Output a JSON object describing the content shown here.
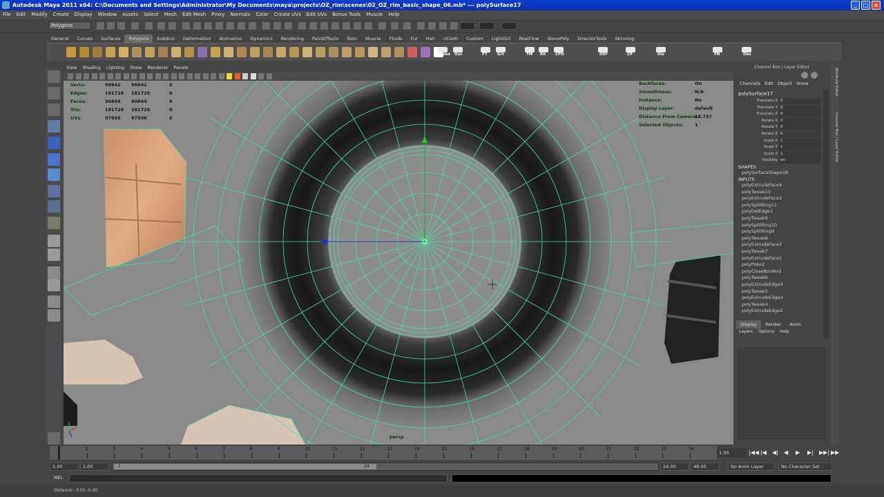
{
  "window": {
    "title": "Autodesk Maya 2011 x64: C:\\Documents and Settings\\Administrator\\My Documents\\maya\\projects\\OZ_rim\\scenes\\02_OZ_rim_basic_shape_06.mb*   ---   polySurface17"
  },
  "menubar": [
    "File",
    "Edit",
    "Modify",
    "Create",
    "Display",
    "Window",
    "Assets",
    "Select",
    "Mesh",
    "Edit Mesh",
    "Proxy",
    "Normals",
    "Color",
    "Create UVs",
    "Edit UVs",
    "Bonus Tools",
    "Muscle",
    "Help"
  ],
  "statusline": {
    "mode": "Polygons"
  },
  "shelf": {
    "tabs": [
      "General",
      "Curves",
      "Surfaces",
      "Polygons",
      "Subdivs",
      "Deformation",
      "Animation",
      "Dynamics",
      "Rendering",
      "PaintEffects",
      "Toon",
      "Muscle",
      "Fluids",
      "Fur",
      "Hair",
      "nCloth",
      "Custom",
      "LightGirl",
      "RealFlow",
      "StevePoly",
      "DirectorTools",
      "Skinning"
    ],
    "active_tab": "Polygons",
    "labels": [
      "Hshd",
      "Out",
      "FT",
      "Grt",
      "TM",
      "All",
      "CPD",
      "DEF",
      "CP",
      "His",
      "FN",
      "Des"
    ]
  },
  "panel": {
    "menus": [
      "View",
      "Shading",
      "Lighting",
      "Show",
      "Renderer",
      "Panels"
    ]
  },
  "hud": {
    "left_rows": [
      {
        "label": "Verts:",
        "a": "98842",
        "b": "98842",
        "c": "0"
      },
      {
        "label": "Edges:",
        "a": "181728",
        "b": "181728",
        "c": "0"
      },
      {
        "label": "Faces:",
        "a": "90864",
        "b": "90864",
        "c": "0"
      },
      {
        "label": "Tris:",
        "a": "181728",
        "b": "181728",
        "c": "0"
      },
      {
        "label": "UVs:",
        "a": "97506",
        "b": "97506",
        "c": "0"
      }
    ],
    "right_rows": [
      {
        "label": "Backfaces:",
        "value": "On"
      },
      {
        "label": "Smoothness:",
        "value": "N/A"
      },
      {
        "label": "Instance:",
        "value": "No"
      },
      {
        "label": "Display Layer:",
        "value": "default"
      },
      {
        "label": "Distance From Camera:",
        "value": "18.737"
      },
      {
        "label": "Selected Objects:",
        "value": "1"
      }
    ],
    "camera": "persp"
  },
  "channel_box": {
    "title": "Channel Box / Layer Editor",
    "menus": [
      "Channels",
      "Edit",
      "Object",
      "Show"
    ],
    "object": "polySurface17",
    "attributes": [
      {
        "name": "Translate X",
        "value": "0"
      },
      {
        "name": "Translate Y",
        "value": "0"
      },
      {
        "name": "Translate Z",
        "value": "0"
      },
      {
        "name": "Rotate X",
        "value": "0"
      },
      {
        "name": "Rotate Y",
        "value": "0"
      },
      {
        "name": "Rotate Z",
        "value": "0"
      },
      {
        "name": "Scale X",
        "value": "1"
      },
      {
        "name": "Scale Y",
        "value": "1"
      },
      {
        "name": "Scale Z",
        "value": "1"
      },
      {
        "name": "Visibility",
        "value": "on"
      }
    ],
    "shapes_header": "SHAPES",
    "shape": "polySurfaceShape18",
    "inputs_header": "INPUTS",
    "inputs": [
      "polyExtrudeFace4",
      "polyTweak10",
      "polyExtrudeFace3",
      "polySplitRing11",
      "polyDelEdge3",
      "polyTweak9",
      "polySplitRing10",
      "polySplitRing9",
      "polyTweak8",
      "polyExtrudeFace2",
      "polyTweak7",
      "polyExtrudeFace1",
      "polyPoke2",
      "polyCloseBorder2",
      "polyTweak6",
      "polyExtrudeEdge4",
      "polyTweak5",
      "polyExtrudeEdge3",
      "polyTweak4",
      "polyExtrudeEdge2"
    ]
  },
  "layer_editor": {
    "tabs": [
      "Display",
      "Render",
      "Anim"
    ],
    "active_tab": "Display",
    "menus": [
      "Layers",
      "Options",
      "Help"
    ]
  },
  "side_tabs": [
    "Attribute Editor",
    "Channel Box / Layer Editor"
  ],
  "timeline": {
    "ticks": [
      "1",
      "2",
      "3",
      "4",
      "5",
      "6",
      "7",
      "8",
      "9",
      "10",
      "11",
      "12",
      "13",
      "14",
      "15",
      "16",
      "17",
      "18",
      "19",
      "20",
      "21",
      "22",
      "23",
      "24"
    ],
    "current_frame": "1.00"
  },
  "range": {
    "start": "1.00",
    "inner_start": "1.00",
    "slider_start": "1",
    "slider_end": "24",
    "inner_end": "24.00",
    "end": "48.00",
    "anim_layer": "No Anim Layer",
    "char_set": "No Character Set"
  },
  "command": {
    "label": "MEL"
  },
  "help_line": "Distance: -0.01  -0.00",
  "colors": {
    "wire": "#3fe0b0",
    "bg": "#444444",
    "viewport": "#8a8a8a"
  }
}
